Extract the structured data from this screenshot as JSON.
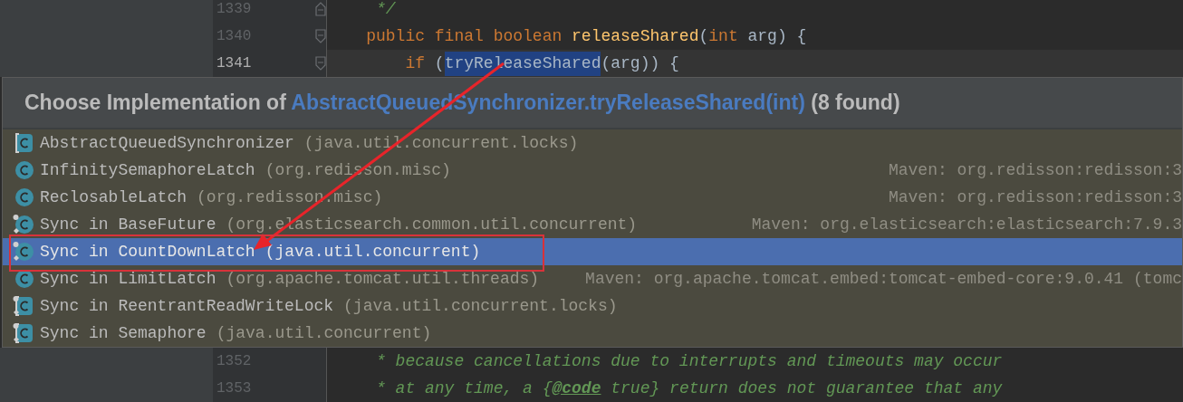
{
  "editor_top": [
    {
      "number": "1339",
      "current": false,
      "kind": "fold_end",
      "segments": [
        {
          "kind": "comment",
          "text": "     */"
        }
      ]
    },
    {
      "number": "1340",
      "current": false,
      "kind": "fold_start",
      "segments": [
        {
          "kind": "keyword",
          "text": "    public final boolean "
        },
        {
          "kind": "method",
          "text": "releaseShared"
        },
        {
          "kind": "plain",
          "text": "("
        },
        {
          "kind": "keyword",
          "text": "int"
        },
        {
          "kind": "plain",
          "text": " arg) {"
        }
      ]
    },
    {
      "number": "1341",
      "current": true,
      "kind": "fold_start",
      "segments": [
        {
          "kind": "keyword",
          "text": "        if "
        },
        {
          "kind": "plain",
          "text": "("
        },
        {
          "kind": "selected",
          "text": "tryReleaseShared"
        },
        {
          "kind": "plain",
          "text": "(arg)) {"
        }
      ]
    }
  ],
  "popup": {
    "title": {
      "prefix": "Choose Implementation of",
      "target": "AbstractQueuedSynchronizer.tryReleaseShared(int)",
      "count": "(8 found)"
    },
    "items": [
      {
        "kind": "abstract",
        "name": "AbstractQueuedSynchronizer",
        "package": "(java.util.concurrent.locks)",
        "selected": false
      },
      {
        "kind": "class",
        "name": "InfinitySemaphoreLatch",
        "package": "(org.redisson.misc)",
        "location": "Maven: org.redisson:redisson:3",
        "selected": false
      },
      {
        "kind": "class",
        "name": "ReclosableLatch",
        "package": "(org.redisson.misc)",
        "location": "Maven: org.redisson:redisson:3",
        "selected": false
      },
      {
        "kind": "inner",
        "name": "Sync in BaseFuture",
        "package": "(org.elasticsearch.common.util.concurrent)",
        "location": "Maven: org.elasticsearch:elasticsearch:7.9.3",
        "selected": false
      },
      {
        "kind": "inner",
        "name": "Sync in CountDownLatch",
        "package": "(java.util.concurrent)",
        "selected": true
      },
      {
        "kind": "class",
        "name": "Sync in LimitLatch",
        "package": "(org.apache.tomcat.util.threads)",
        "location": "Maven: org.apache.tomcat.embed:tomcat-embed-core:9.0.41 (tomc",
        "selected": false
      },
      {
        "kind": "inner_abstract",
        "name": "Sync in ReentrantReadWriteLock",
        "package": "(java.util.concurrent.locks)",
        "selected": false
      },
      {
        "kind": "inner_abstract",
        "name": "Sync in Semaphore",
        "package": "(java.util.concurrent)",
        "selected": false
      }
    ]
  },
  "editor_bottom": [
    {
      "number": "1352",
      "segments": [
        {
          "kind": "comment",
          "text": "     * because cancellations due to interrupts and timeouts may occur"
        }
      ]
    },
    {
      "number": "1353",
      "segments": [
        {
          "kind": "comment",
          "text": "     * at any time, a {"
        },
        {
          "kind": "doc_tag",
          "text": "@code"
        },
        {
          "kind": "comment",
          "text": " true} return does not guarantee that any"
        }
      ]
    }
  ]
}
